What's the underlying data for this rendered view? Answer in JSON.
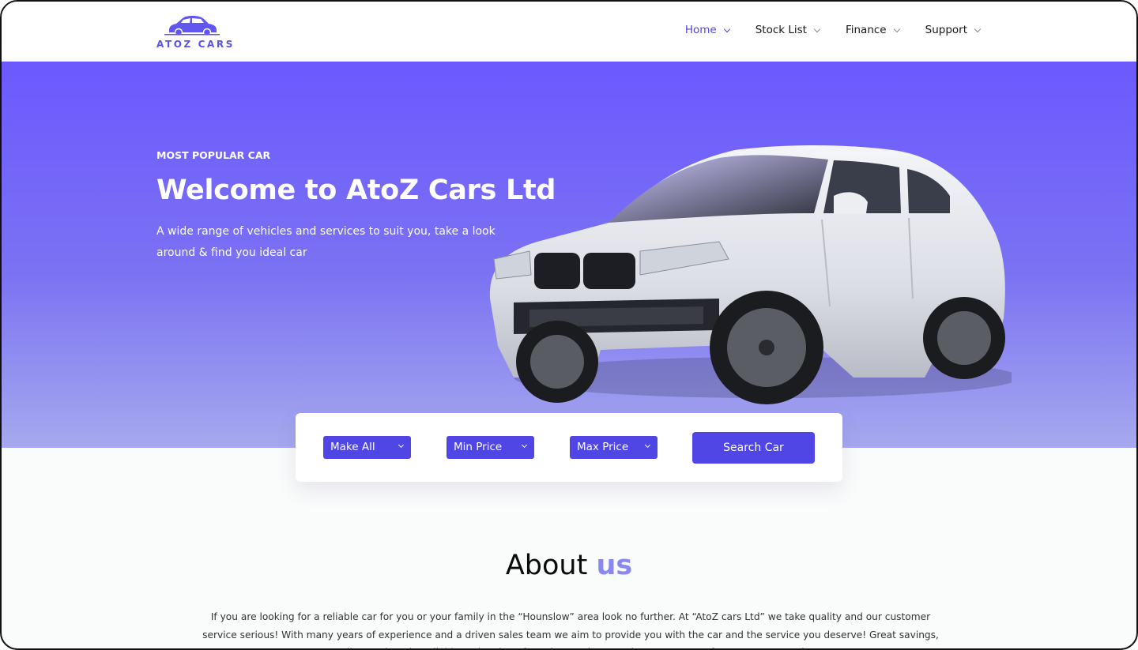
{
  "header": {
    "logo_text": "ATOZ CARS",
    "nav": [
      {
        "label": "Home",
        "active": true
      },
      {
        "label": "Stock List",
        "active": false
      },
      {
        "label": "Finance",
        "active": false
      },
      {
        "label": "Support",
        "active": false
      }
    ]
  },
  "hero": {
    "eyebrow": "MOST POPULAR CAR",
    "title": "Welcome to AtoZ Cars Ltd",
    "subtitle": "A wide range of vehicles and services to suit you, take a look around & find you ideal car"
  },
  "search": {
    "make": "Make All",
    "min_price": "Min Price",
    "max_price": "Max Price",
    "button": "Search Car"
  },
  "about": {
    "title_main": "About",
    "title_accent": "us",
    "text": "If you are looking for a reliable car for you or your family in the “Hounslow” area look no further. At “AtoZ cars Ltd” we take quality and our customer service serious! With many years of experience and a driven sales team we aim to provide you with the car and the service you deserve! Great savings, quality stock and a reliable and caring aftersales service are what set us apart from “AtoZ cars Ltd”."
  },
  "colors": {
    "accent": "#4f46e5",
    "hero_top": "#6b59ff",
    "hero_bottom": "#a6a9ee",
    "about_accent": "#8b87f0"
  },
  "icons": [
    "car-logo-icon",
    "chevron-down-icon"
  ]
}
